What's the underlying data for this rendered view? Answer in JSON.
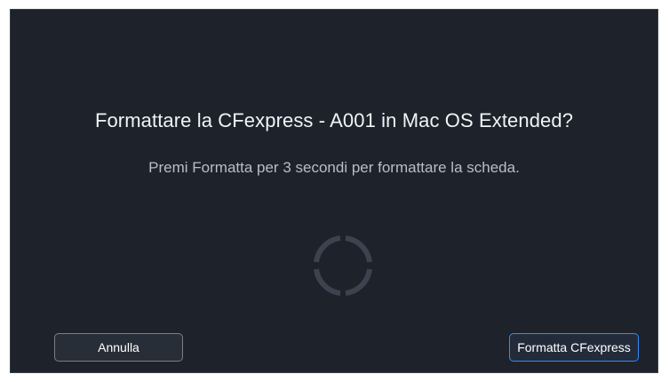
{
  "dialog": {
    "title": "Formattare la CFexpress - A001 in Mac OS Extended?",
    "subtitle": "Premi Formatta per 3 secondi per formattare la scheda.",
    "progress": 0.0
  },
  "buttons": {
    "cancel_label": "Annulla",
    "format_label": "Formatta CFexpress"
  },
  "colors": {
    "background": "#1d222b",
    "accent": "#2f8cff",
    "ring": "#3c434e"
  }
}
